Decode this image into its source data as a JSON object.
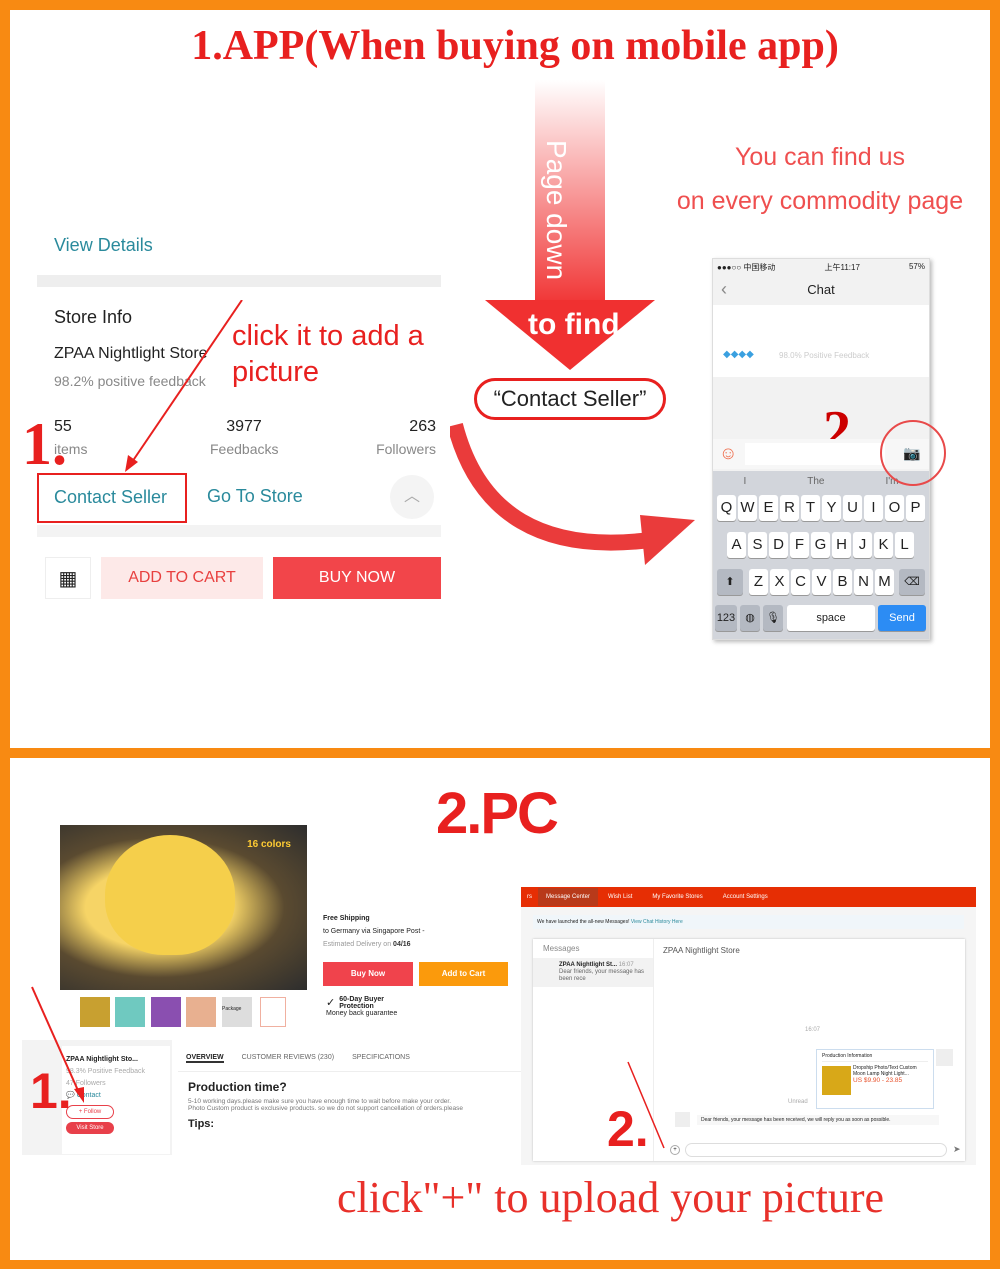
{
  "top": {
    "heading": "1.APP(When buying on mobile app)",
    "app": {
      "view_details": "View Details",
      "store_info": "Store Info",
      "store_name": "ZPAA Nightlight Store",
      "feedback": "98.2% positive feedback",
      "stats": [
        {
          "value": "55",
          "label": "items"
        },
        {
          "value": "3977",
          "label": "Feedbacks"
        },
        {
          "value": "263",
          "label": "Followers"
        }
      ],
      "contact_seller": "Contact Seller",
      "go_to_store": "Go To Store",
      "add_to_cart": "ADD TO CART",
      "buy_now": "BUY NOW"
    },
    "annotation_add_picture": "click it to add a picture",
    "step1": "1.",
    "arrow_text": "Page down",
    "to_find": "to find",
    "contact_seller_quote": "“Contact Seller”",
    "find_us_line1": "You can find us",
    "find_us_line2": "on every commodity page",
    "phone": {
      "status_left": "●●●○○ 中国移动",
      "status_time": "上午11:17",
      "status_right": "57%",
      "title": "Chat",
      "feedback": "98.0% Positive Feedback",
      "step2": "2.",
      "suggestions": [
        "I",
        "The",
        "I'm"
      ],
      "row1": [
        "Q",
        "W",
        "E",
        "R",
        "T",
        "Y",
        "U",
        "I",
        "O",
        "P"
      ],
      "row2": [
        "A",
        "S",
        "D",
        "F",
        "G",
        "H",
        "J",
        "K",
        "L"
      ],
      "row3": [
        "Z",
        "X",
        "C",
        "V",
        "B",
        "N",
        "M"
      ],
      "key_123": "123",
      "key_space": "space",
      "key_send": "Send"
    }
  },
  "bottom": {
    "heading": "2.PC",
    "badge": "16 colors",
    "shipping": {
      "title": "Free Shipping",
      "line": "to Germany via Singapore Post -",
      "delivery_label": "Estimated Delivery on",
      "delivery_date": "04/16"
    },
    "buy_now": "Buy Now",
    "add_to_cart": "Add to Cart",
    "protection_title": "60-Day Buyer Protection",
    "protection_sub": "Money back guarantee",
    "thumb_package": "Package",
    "store": {
      "name": "ZPAA Nightlight Sto...",
      "feedback": "98.3% Positive Feedback",
      "followers": "47 Followers",
      "contact": "Contact",
      "follow": "+ Follow",
      "visit": "Visit Store"
    },
    "tabs": [
      "OVERVIEW",
      "CUSTOMER REVIEWS (230)",
      "SPECIFICATIONS"
    ],
    "prod_title": "Production time?",
    "prod_line1": "5-10 working days.please make sure you have enough time to wait before make your order.",
    "prod_line2": "Photo Custom product is exclusive products. so we do not support cancellation of orders.please",
    "tips": "Tips:",
    "step1": "1.",
    "step2": "2.",
    "msg": {
      "nav": [
        "rs",
        "Message Center",
        "Wish List",
        "My Favorite Stores",
        "Account Settings"
      ],
      "notice": "We have launched the all-new Messages!",
      "notice_link": "View Chat History Here",
      "messages_label": "Messages",
      "conv_name": "ZPAA Nightlight St...",
      "conv_time": "16:07",
      "conv_preview": "Dear friends, your message has been rece",
      "chat_title": "ZPAA Nightlight Store",
      "time": "16:07",
      "card_title": "Production Information",
      "card_product": "Dropship Photo/Text Custom Moon Lamp Night Light...",
      "card_price": "US $9.90 - 23.85",
      "unread": "Unread",
      "reply": "Dear friends, your message has been received, we will reply you as soon as possible."
    },
    "footer": "click\"+\" to upload your picture"
  },
  "colors": {
    "frame": "#f88a12",
    "red": "#e8201f",
    "teal": "#2a8a9c",
    "aliexpress": "#e62e04"
  }
}
